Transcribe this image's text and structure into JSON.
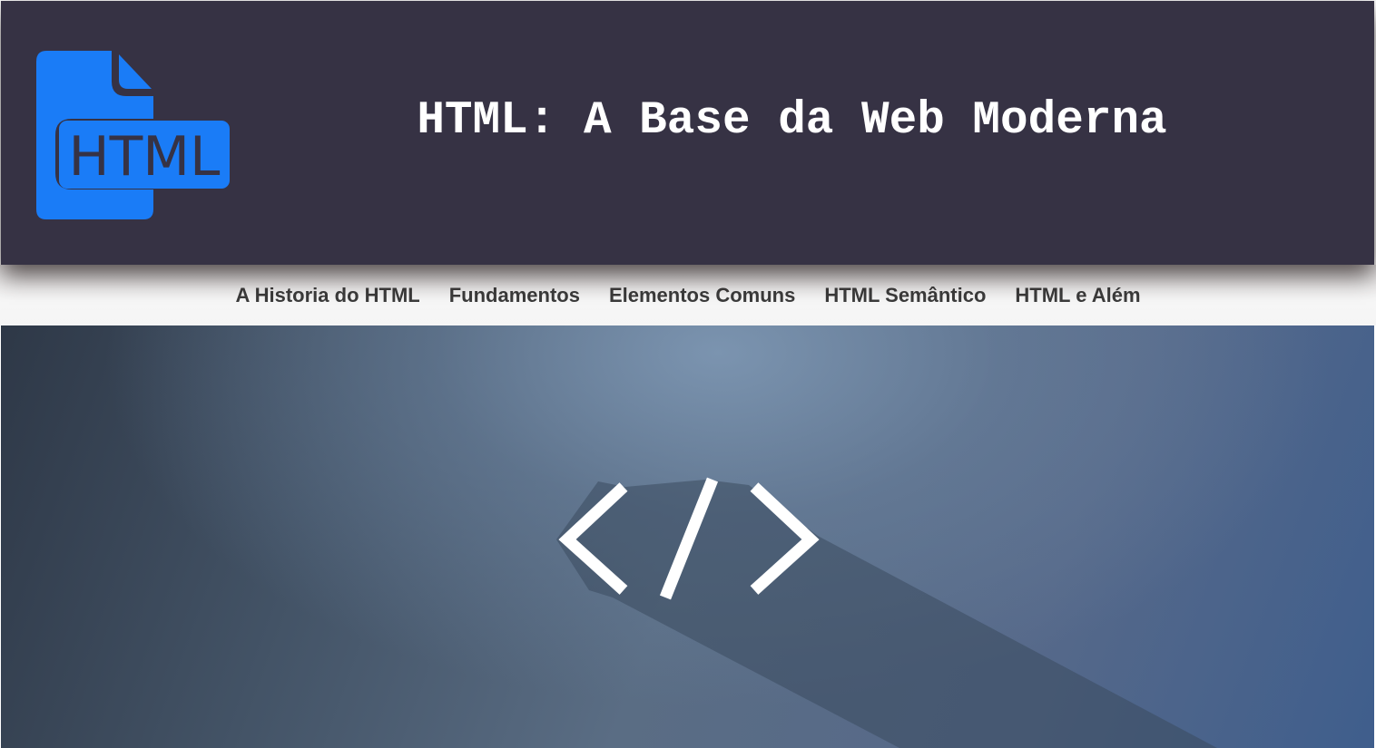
{
  "header": {
    "title": "HTML: A Base da Web Moderna",
    "logo_text": "HTML",
    "logo_icon": "html-file-icon",
    "logo_color": "#1a7cf7",
    "background_color": "#363244"
  },
  "nav": {
    "items": [
      {
        "label": "A Historia do HTML"
      },
      {
        "label": "Fundamentos"
      },
      {
        "label": "Elementos Comuns"
      },
      {
        "label": "HTML Semântico"
      },
      {
        "label": "HTML e Além"
      }
    ]
  },
  "hero": {
    "icon": "code-tag-icon",
    "icon_color": "#ffffff"
  }
}
